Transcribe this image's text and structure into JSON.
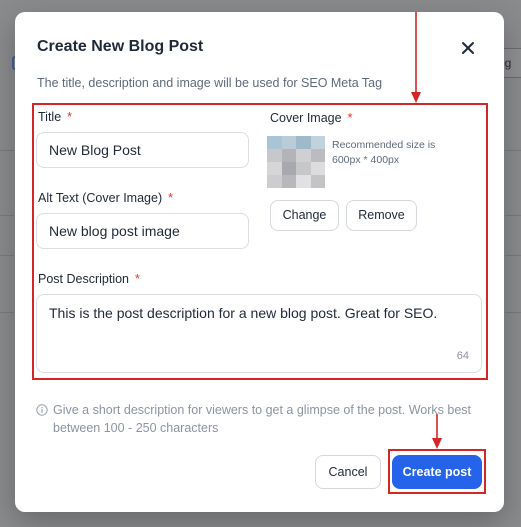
{
  "background": {
    "chip_label": "og"
  },
  "modal": {
    "title": "Create New Blog Post",
    "subtitle": "The title, description and image will be used for SEO Meta Tag",
    "title_field": {
      "label": "Title",
      "required": "*",
      "value": "New Blog Post"
    },
    "alt_field": {
      "label": "Alt Text (Cover Image)",
      "required": "*",
      "value": "New blog post image"
    },
    "cover": {
      "label": "Cover Image",
      "required": "*",
      "hint_line1": "Recommended size is",
      "hint_line2": "600px * 400px",
      "change_label": "Change",
      "remove_label": "Remove"
    },
    "description": {
      "label": "Post Description",
      "required": "*",
      "value": "This is the post description for a new blog post. Great for SEO.",
      "counter": "64"
    },
    "info_text": "Give a short description for viewers to get a glimpse of the post. Works best between 100 - 250 characters",
    "cancel_label": "Cancel",
    "create_label": "Create post"
  },
  "colors": {
    "accent": "#2563eb",
    "required": "#e0352b",
    "annotation": "#d42626"
  },
  "icons": {
    "close": "close-icon",
    "info": "info-icon"
  }
}
